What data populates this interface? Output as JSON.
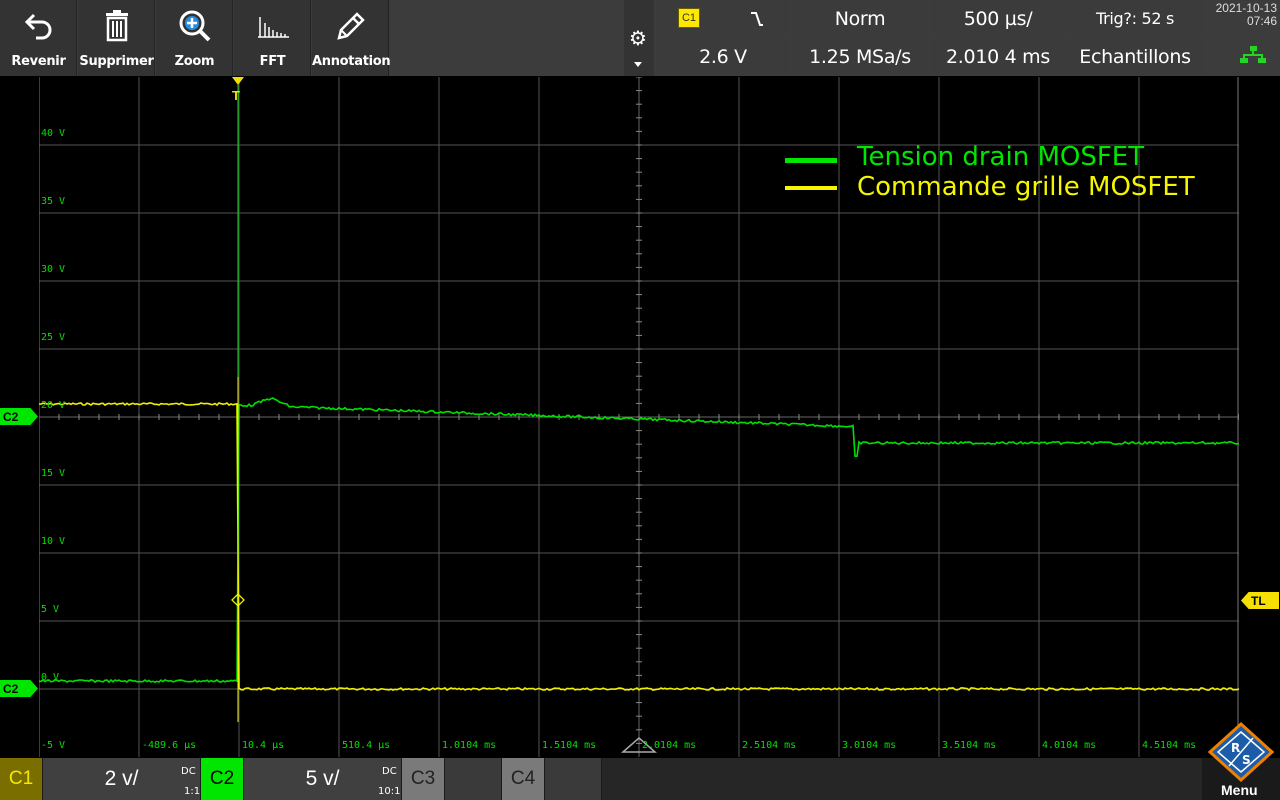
{
  "toolbar": {
    "buttons": [
      {
        "label": "Revenir",
        "icon": "undo-icon"
      },
      {
        "label": "Supprimer",
        "icon": "trash-icon"
      },
      {
        "label": "Zoom",
        "icon": "zoom-in-icon"
      },
      {
        "label": "FFT",
        "icon": "fft-icon"
      },
      {
        "label": "Annotation",
        "icon": "pencil-icon"
      }
    ]
  },
  "status": {
    "trigger_source": "C1",
    "trigger_level": "2.6 V",
    "trigger_mode": "Norm",
    "sample_rate": "1.25 MSa/s",
    "timebase": "500 µs/",
    "acq_time": "2.010 4 ms",
    "trigger_status": "Trig?: 52 s",
    "acq_mode": "Echantillons",
    "date": "2021-10-13",
    "time": "07:46"
  },
  "plot": {
    "y_labels": [
      "40 V",
      "35 V",
      "30 V",
      "25 V",
      "20 V",
      "15 V",
      "10 V",
      "5 V",
      "0 V",
      "-5 V"
    ],
    "x_labels": [
      "-489.6 µs",
      "10.4 µs",
      "510.4 µs",
      "1.0104 ms",
      "1.5104 ms",
      "2.0104 ms",
      "2.5104 ms",
      "3.0104 ms",
      "3.5104 ms",
      "4.0104 ms",
      "4.5104 ms"
    ],
    "trigger_marker": "T",
    "left_marker_top": "C2",
    "left_marker_bottom": "C2",
    "right_marker": "TL"
  },
  "legend": {
    "items": [
      {
        "label": "Tension drain MOSFET",
        "color": "#00e600"
      },
      {
        "label": "Commande grille MOSFET",
        "color": "#f5f500"
      }
    ]
  },
  "channels": {
    "c1": {
      "name": "C1",
      "scale": "2 v/",
      "coupling": "DC",
      "ratio": "1:1",
      "color": "#ffe800"
    },
    "c2": {
      "name": "C2",
      "scale": "5 v/",
      "coupling": "DC",
      "ratio": "10:1",
      "color": "#00e600"
    },
    "c3": {
      "name": "C3"
    },
    "c4": {
      "name": "C4"
    },
    "menu_label": "Menu"
  }
}
